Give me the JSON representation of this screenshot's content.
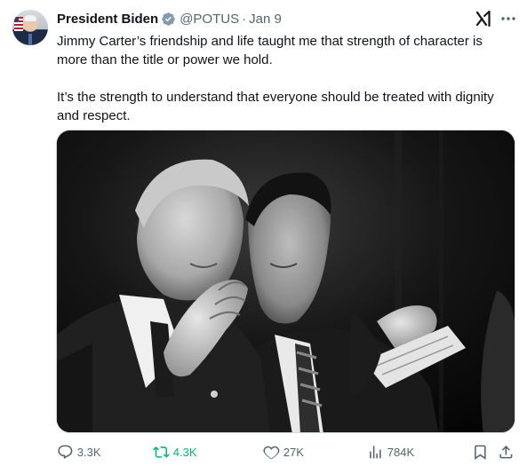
{
  "tweet": {
    "author_name": "President Biden",
    "handle": "@POTUS",
    "separator": "·",
    "date": "Jan 9",
    "paragraphs": [
      "Jimmy Carter’s friendship and life taught me that strength of character is more than the title or power we hold.",
      "It’s the strength to understand that everyone should be treated with dignity and respect."
    ]
  },
  "actions": {
    "replies": "3.3K",
    "reposts": "4.3K",
    "likes": "27K",
    "views": "784K"
  },
  "icons": {
    "verified": "verified-badge-icon",
    "grok": "grok-icon",
    "more": "more-icon",
    "reply": "reply-icon",
    "repost": "repost-icon",
    "like": "heart-icon",
    "views": "analytics-icon",
    "bookmark": "bookmark-icon",
    "share": "share-icon"
  },
  "colors": {
    "text": "#0f1419",
    "secondary": "#536471",
    "verified": "#829aab",
    "repost_active": "#00ba7c",
    "border": "#cfd9de"
  }
}
